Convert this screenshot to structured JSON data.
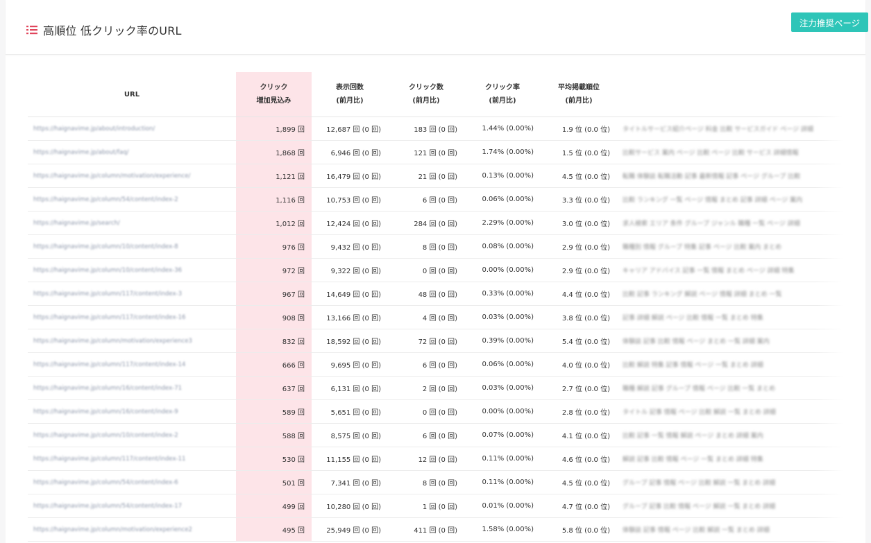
{
  "header": {
    "title": "高順位 低クリック率のURL",
    "button_label": "注力推奨ページ"
  },
  "colors": {
    "accent": "#2ec5b8",
    "highlight_column": "#fde4e8",
    "title_icon": "#e0465d"
  },
  "table": {
    "columns": [
      {
        "key": "url",
        "line1": "URL",
        "line2": ""
      },
      {
        "key": "gain",
        "line1": "クリック",
        "line2": "増加見込み"
      },
      {
        "key": "impressions",
        "line1": "表示回数",
        "line2": "(前月比)"
      },
      {
        "key": "clicks",
        "line1": "クリック数",
        "line2": "(前月比)"
      },
      {
        "key": "ctr",
        "line1": "クリック率",
        "line2": "(前月比)"
      },
      {
        "key": "position",
        "line1": "平均掲載順位",
        "line2": "(前月比)"
      },
      {
        "key": "title",
        "line1": "",
        "line2": ""
      }
    ],
    "rows": [
      {
        "url": "https://haignavime.jp/about/introduction/",
        "gain": "1,899 回",
        "impressions": "12,687 回 (0 回)",
        "clicks": "183 回 (0 回)",
        "ctr": "1.44% (0.00%)",
        "position": "1.9 位 (0.0 位)",
        "title": "タイトルサービス紹介ページ 料金 比較 サービスガイド ページ 詳細"
      },
      {
        "url": "https://haignavime.jp/about/faq/",
        "gain": "1,868 回",
        "impressions": "6,946 回 (0 回)",
        "clicks": "121 回 (0 回)",
        "ctr": "1.74% (0.00%)",
        "position": "1.5 位 (0.0 位)",
        "title": "比較サービス 案内 ページ 比較 ページ 比較 サービス 詳細情報"
      },
      {
        "url": "https://haignavime.jp/column/motivation/experience/",
        "gain": "1,121 回",
        "impressions": "16,479 回 (0 回)",
        "clicks": "21 回 (0 回)",
        "ctr": "0.13% (0.00%)",
        "position": "4.5 位 (0.0 位)",
        "title": "転職 体験談 転職活動 記事 最新情報 記事 ページ グループ 比較"
      },
      {
        "url": "https://haignavime.jp/column/54/content/index-2",
        "gain": "1,116 回",
        "impressions": "10,753 回 (0 回)",
        "clicks": "6 回 (0 回)",
        "ctr": "0.06% (0.00%)",
        "position": "3.3 位 (0.0 位)",
        "title": "比較 ランキング 一覧 ページ 情報 まとめ 記事 詳細 ページ 案内"
      },
      {
        "url": "https://haignavime.jp/search/",
        "gain": "1,012 回",
        "impressions": "12,424 回 (0 回)",
        "clicks": "284 回 (0 回)",
        "ctr": "2.29% (0.00%)",
        "position": "3.0 位 (0.0 位)",
        "title": "求人検索 エリア 条件 グループ ジャンル 職種 一覧 ページ 詳細"
      },
      {
        "url": "https://haignavime.jp/column/10/content/index-8",
        "gain": "976 回",
        "impressions": "9,432 回 (0 回)",
        "clicks": "8 回 (0 回)",
        "ctr": "0.08% (0.00%)",
        "position": "2.9 位 (0.0 位)",
        "title": "職種別 情報 グループ 特集 記事 ページ 比較 案内 まとめ"
      },
      {
        "url": "https://haignavime.jp/column/10/content/index-36",
        "gain": "972 回",
        "impressions": "9,322 回 (0 回)",
        "clicks": "0 回 (0 回)",
        "ctr": "0.00% (0.00%)",
        "position": "2.9 位 (0.0 位)",
        "title": "キャリア アドバイス 記事 一覧 情報 まとめ ページ 詳細 特集"
      },
      {
        "url": "https://haignavime.jp/column/117/content/index-3",
        "gain": "967 回",
        "impressions": "14,649 回 (0 回)",
        "clicks": "48 回 (0 回)",
        "ctr": "0.33% (0.00%)",
        "position": "4.4 位 (0.0 位)",
        "title": "比較 記事 ランキング 解説 ページ 情報 詳細 まとめ 一覧"
      },
      {
        "url": "https://haignavime.jp/column/117/content/index-16",
        "gain": "908 回",
        "impressions": "13,166 回 (0 回)",
        "clicks": "4 回 (0 回)",
        "ctr": "0.03% (0.00%)",
        "position": "3.8 位 (0.0 位)",
        "title": "記事 詳細 解説 ページ 比較 情報 一覧 まとめ 特集"
      },
      {
        "url": "https://haignavime.jp/column/motivation/experience3",
        "gain": "832 回",
        "impressions": "18,592 回 (0 回)",
        "clicks": "72 回 (0 回)",
        "ctr": "0.39% (0.00%)",
        "position": "5.4 位 (0.0 位)",
        "title": "体験談 記事 比較 情報 ページ まとめ 一覧 詳細 案内"
      },
      {
        "url": "https://haignavime.jp/column/117/content/index-14",
        "gain": "666 回",
        "impressions": "9,695 回 (0 回)",
        "clicks": "6 回 (0 回)",
        "ctr": "0.06% (0.00%)",
        "position": "4.0 位 (0.0 位)",
        "title": "比較 解説 特集 記事 情報 ページ 一覧 まとめ 詳細"
      },
      {
        "url": "https://haignavime.jp/column/16/content/index-71",
        "gain": "637 回",
        "impressions": "6,131 回 (0 回)",
        "clicks": "2 回 (0 回)",
        "ctr": "0.03% (0.00%)",
        "position": "2.7 位 (0.0 位)",
        "title": "職種 解説 記事 グループ 情報 ページ 比較 一覧 まとめ"
      },
      {
        "url": "https://haignavime.jp/column/16/content/index-9",
        "gain": "589 回",
        "impressions": "5,651 回 (0 回)",
        "clicks": "0 回 (0 回)",
        "ctr": "0.00% (0.00%)",
        "position": "2.8 位 (0.0 位)",
        "title": "タイトル 記事 情報 ページ 比較 解説 一覧 まとめ 詳細"
      },
      {
        "url": "https://haignavime.jp/column/10/content/index-2",
        "gain": "588 回",
        "impressions": "8,575 回 (0 回)",
        "clicks": "6 回 (0 回)",
        "ctr": "0.07% (0.00%)",
        "position": "4.1 位 (0.0 位)",
        "title": "比較 記事 一覧 情報 解説 ページ まとめ 詳細 案内"
      },
      {
        "url": "https://haignavime.jp/column/117/content/index-11",
        "gain": "530 回",
        "impressions": "11,155 回 (0 回)",
        "clicks": "12 回 (0 回)",
        "ctr": "0.11% (0.00%)",
        "position": "4.6 位 (0.0 位)",
        "title": "解説 記事 比較 情報 ページ 一覧 まとめ 詳細 特集"
      },
      {
        "url": "https://haignavime.jp/column/54/content/index-6",
        "gain": "501 回",
        "impressions": "7,341 回 (0 回)",
        "clicks": "8 回 (0 回)",
        "ctr": "0.11% (0.00%)",
        "position": "4.5 位 (0.0 位)",
        "title": "グループ 記事 情報 ページ 比較 解説 一覧 まとめ 詳細"
      },
      {
        "url": "https://haignavime.jp/column/54/content/index-17",
        "gain": "499 回",
        "impressions": "10,280 回 (0 回)",
        "clicks": "1 回 (0 回)",
        "ctr": "0.01% (0.00%)",
        "position": "4.7 位 (0.0 位)",
        "title": "グループ 記事 比較 情報 ページ 解説 一覧 まとめ 詳細"
      },
      {
        "url": "https://haignavime.jp/column/motivation/experience2",
        "gain": "495 回",
        "impressions": "25,949 回 (0 回)",
        "clicks": "411 回 (0 回)",
        "ctr": "1.58% (0.00%)",
        "position": "5.8 位 (0.0 位)",
        "title": "体験談 記事 情報 ページ 比較 解説 一覧 まとめ 詳細"
      }
    ]
  }
}
